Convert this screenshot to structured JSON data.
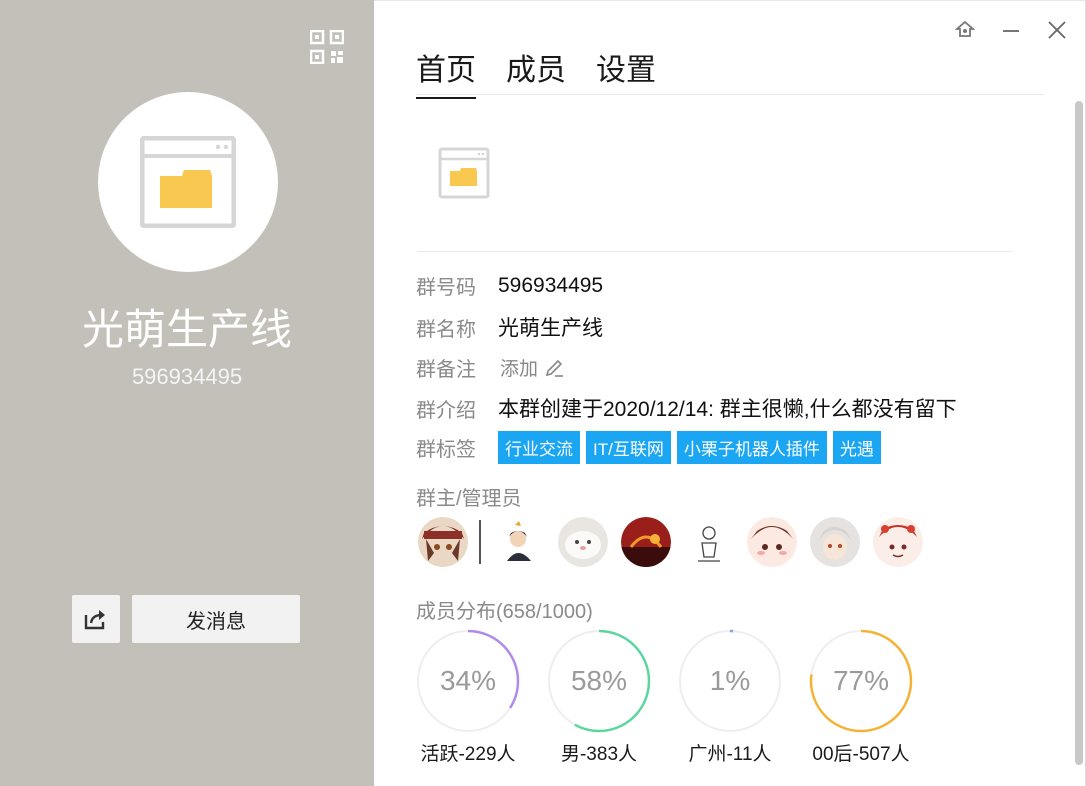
{
  "left": {
    "group_name": "光萌生产线",
    "group_id": "596934495",
    "send_button": "发消息"
  },
  "tabs": [
    "首页",
    "成员",
    "设置"
  ],
  "info": {
    "number_label": "群号码",
    "number_value": "596934495",
    "name_label": "群名称",
    "name_value": "光萌生产线",
    "remark_label": "群备注",
    "remark_value": "添加",
    "intro_label": "群介绍",
    "intro_value": "本群创建于2020/12/14:  群主很懒,什么都没有留下",
    "tags_label": "群标签",
    "tags": [
      "行业交流",
      "IT/互联网",
      "小栗子机器人插件",
      "光遇"
    ]
  },
  "admins_title": "群主/管理员",
  "members": {
    "title": "成员分布",
    "count": "(658/1000)",
    "stats": [
      {
        "value": "34%",
        "percent": 34,
        "label": "活跃-229人",
        "color": "#b08ce8"
      },
      {
        "value": "58%",
        "percent": 58,
        "label": "男-383人",
        "color": "#5cd6a0"
      },
      {
        "value": "1%",
        "percent": 1,
        "label": "广州-11人",
        "color": "#7aa8e8"
      },
      {
        "value": "77%",
        "percent": 77,
        "label": "00后-507人",
        "color": "#f5b335"
      }
    ]
  },
  "colors": {
    "left_bg": "#c3c0ba",
    "tag_bg": "#1aa6f2"
  }
}
